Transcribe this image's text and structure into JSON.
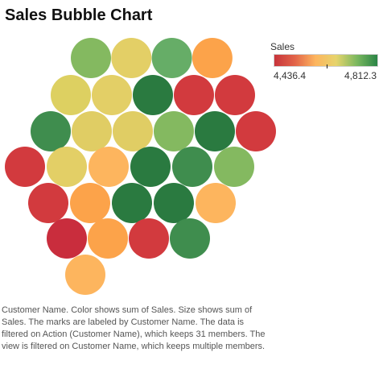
{
  "title": "Sales Bubble Chart",
  "legend": {
    "title": "Sales",
    "min_label": "4,436.4",
    "max_label": "4,812.3",
    "colors": [
      "#c7343b",
      "#e26449",
      "#fdb55e",
      "#e6d46c",
      "#7bb85f",
      "#2a8446"
    ]
  },
  "caption": "Customer Name.  Color shows sum of Sales.  Size shows sum of Sales.  The marks are labeled by Customer Name. The data is filtered on Action (Customer Name), which keeps 31 members. The view is filtered on Customer Name, which keeps multiple members.",
  "chart_data": {
    "type": "bubble",
    "color_measure": "Sales",
    "size_measure": "Sales",
    "color_range": [
      4436.4,
      4812.3
    ],
    "bubbles": [
      {
        "color": "#84b960"
      },
      {
        "color": "#e3cf66"
      },
      {
        "color": "#66ad67"
      },
      {
        "color": "#fca34a"
      },
      {
        "color": "#ddd061"
      },
      {
        "color": "#e3cf66"
      },
      {
        "color": "#2a7a40"
      },
      {
        "color": "#d23a3e"
      },
      {
        "color": "#d23a3e"
      },
      {
        "color": "#3f8d4e"
      },
      {
        "color": "#e0cd64"
      },
      {
        "color": "#e0cd64"
      },
      {
        "color": "#84b960"
      },
      {
        "color": "#2a7a40"
      },
      {
        "color": "#d23a3e"
      },
      {
        "color": "#d23a3e"
      },
      {
        "color": "#e3cf66"
      },
      {
        "color": "#fdb55e"
      },
      {
        "color": "#2a7a40"
      },
      {
        "color": "#3f8d4e"
      },
      {
        "color": "#84b960"
      },
      {
        "color": "#d23a3e"
      },
      {
        "color": "#fca34a"
      },
      {
        "color": "#2a7a40"
      },
      {
        "color": "#2a7a40"
      },
      {
        "color": "#fdb55e"
      },
      {
        "color": "#c92d3d"
      },
      {
        "color": "#fca34a"
      },
      {
        "color": "#d23a3e"
      },
      {
        "color": "#3f8d4e"
      },
      {
        "color": "#fdb55e"
      }
    ]
  }
}
